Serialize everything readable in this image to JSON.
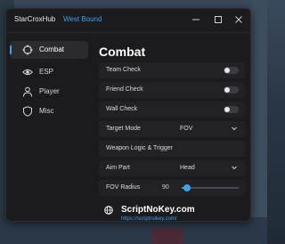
{
  "titlebar": {
    "app_name": "StarCroxHub",
    "subtitle": "West Bound",
    "controls": [
      "minimize-icon",
      "maximize-icon",
      "close-icon"
    ]
  },
  "sidebar": {
    "items": [
      {
        "label": "Combat",
        "icon": "crosshair-icon",
        "active": true
      },
      {
        "label": "ESP",
        "icon": "eye-icon",
        "active": false
      },
      {
        "label": "Player",
        "icon": "user-icon",
        "active": false
      },
      {
        "label": "Misc",
        "icon": "shield-icon",
        "active": false
      }
    ]
  },
  "content": {
    "title": "Combat",
    "rows": [
      {
        "label": "Team Check",
        "type": "toggle",
        "on": false
      },
      {
        "label": "Friend Check",
        "type": "toggle",
        "on": false
      },
      {
        "label": "Wall Check",
        "type": "toggle",
        "on": false
      },
      {
        "label": "Target Mode",
        "type": "dropdown",
        "value": "FOV"
      },
      {
        "label": "Weapon Logic & Trigger",
        "type": "section"
      },
      {
        "label": "Aim Part",
        "type": "dropdown",
        "value": "Head"
      },
      {
        "label": "FOV Radius",
        "type": "slider",
        "value": "90",
        "fill_fraction": 0.1
      }
    ]
  },
  "footer": {
    "brand_name": "ScriptNoKey.com",
    "brand_url": "https://scriptnokey.com/"
  },
  "colors": {
    "accent": "#3fa2ee",
    "window_bg": "#1b1b1e",
    "row_bg": "#222226"
  }
}
